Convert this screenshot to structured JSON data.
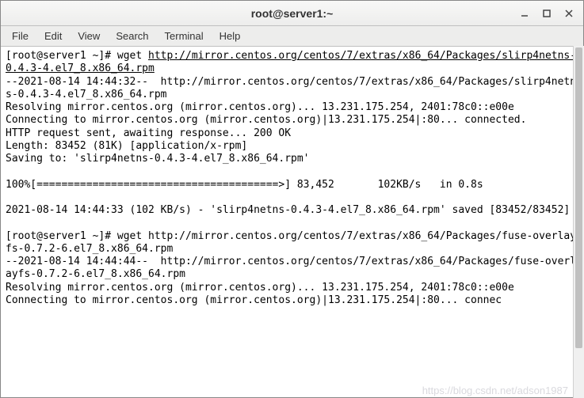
{
  "window": {
    "title": "root@server1:~"
  },
  "menu": {
    "file": "File",
    "edit": "Edit",
    "view": "View",
    "search": "Search",
    "terminal": "Terminal",
    "help": "Help"
  },
  "terminal": {
    "prompt1_user": "[root@server1 ~]# ",
    "cmd1": "wget ",
    "url1": "http://mirror.centos.org/centos/7/extras/x86_64/Packages/slirp4netns-0.4.3-4.el7_8.x86_64.rpm",
    "out1_line1": "--2021-08-14 14:44:32--  http://mirror.centos.org/centos/7/extras/x86_64/Packages/slirp4netns-0.4.3-4.el7_8.x86_64.rpm",
    "out1_line2": "Resolving mirror.centos.org (mirror.centos.org)... 13.231.175.254, 2401:78c0::e00e",
    "out1_line3": "Connecting to mirror.centos.org (mirror.centos.org)|13.231.175.254|:80... connected.",
    "out1_line4": "HTTP request sent, awaiting response... 200 OK",
    "out1_line5": "Length: 83452 (81K) [application/x-rpm]",
    "out1_line6": "Saving to: 'slirp4netns-0.4.3-4.el7_8.x86_64.rpm'",
    "out1_blank1": "",
    "out1_progress": "100%[=======================================>] 83,452       102KB/s   in 0.8s",
    "out1_blank2": "",
    "out1_saved": "2021-08-14 14:44:33 (102 KB/s) - 'slirp4netns-0.4.3-4.el7_8.x86_64.rpm' saved [83452/83452]",
    "out1_blank3": "",
    "prompt2_user": "[root@server1 ~]# ",
    "cmd2": "wget http://mirror.centos.org/centos/7/extras/x86_64/Packages/fuse-overlayfs-0.7.2-6.el7_8.x86_64.rpm",
    "out2_line1": "--2021-08-14 14:44:44--  http://mirror.centos.org/centos/7/extras/x86_64/Packages/fuse-overlayfs-0.7.2-6.el7_8.x86_64.rpm",
    "out2_line2": "Resolving mirror.centos.org (mirror.centos.org)... 13.231.175.254, 2401:78c0::e00e",
    "out2_line3": "Connecting to mirror.centos.org (mirror.centos.org)|13.231.175.254|:80... connec"
  },
  "watermark": "https://blog.csdn.net/adson1987"
}
